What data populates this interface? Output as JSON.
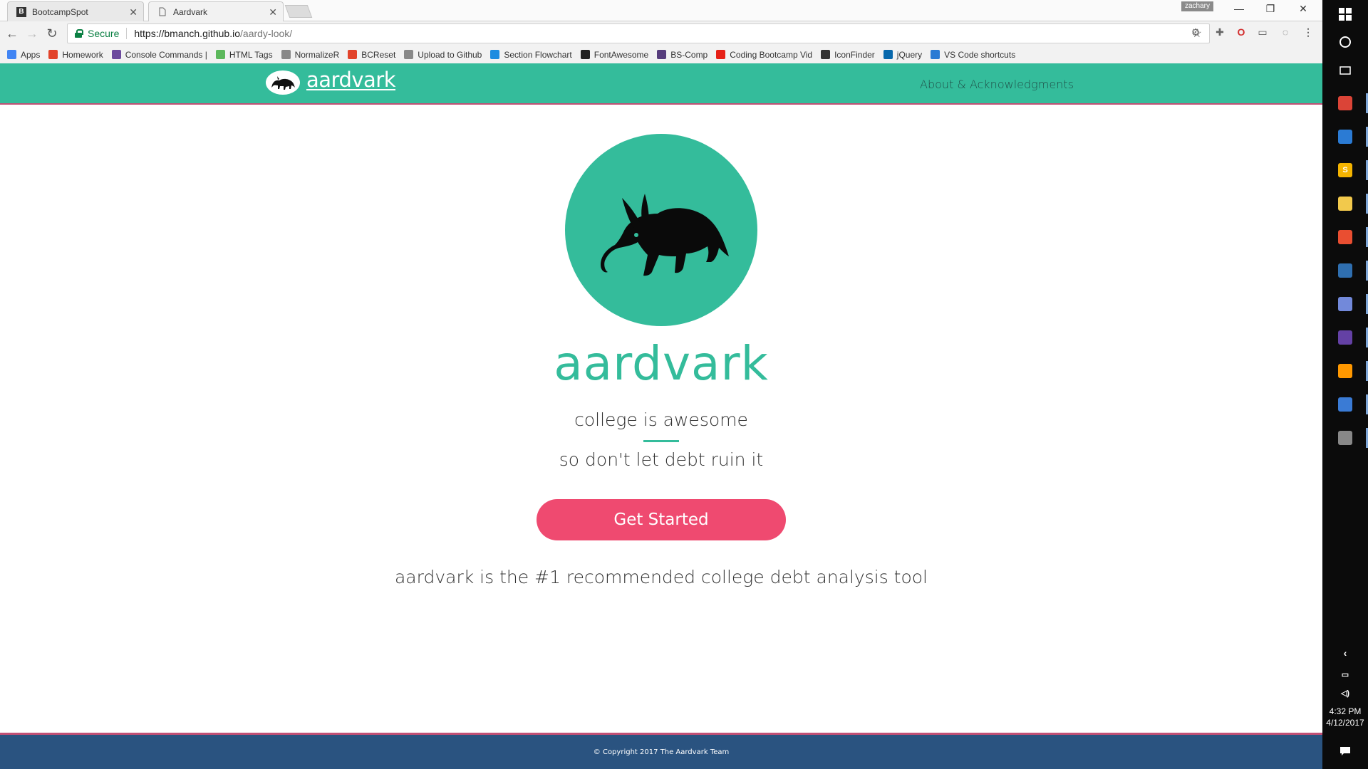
{
  "browser": {
    "tabs": [
      {
        "label": "BootcampSpot",
        "favicon": "B"
      },
      {
        "label": "Aardvark",
        "favicon": "page-icon"
      }
    ],
    "user_badge": "zachary",
    "address": {
      "secure_label": "Secure",
      "url_host": "https://bmanch.github.io",
      "url_path": "/aardy-look/"
    },
    "bookmarks": [
      {
        "label": "Apps",
        "icon": "apps-grid-icon",
        "color": "#4285f4"
      },
      {
        "label": "Homework",
        "icon": "gitlab-icon",
        "color": "#e2432a"
      },
      {
        "label": "Console Commands |",
        "icon": "slack-icon",
        "color": "#6c4a9e"
      },
      {
        "label": "HTML Tags",
        "icon": "html-icon",
        "color": "#5cb85c"
      },
      {
        "label": "NormalizeR",
        "icon": "page-icon",
        "color": "#888888"
      },
      {
        "label": "BCReset",
        "icon": "gitlab-icon",
        "color": "#e2432a"
      },
      {
        "label": "Upload to Github",
        "icon": "page-icon",
        "color": "#888888"
      },
      {
        "label": "Section Flowchart",
        "icon": "flowchart-icon",
        "color": "#1d8ce0"
      },
      {
        "label": "FontAwesome",
        "icon": "flag-icon",
        "color": "#222222"
      },
      {
        "label": "BS-Comp",
        "icon": "bootstrap-icon",
        "color": "#563d7c"
      },
      {
        "label": "Coding Bootcamp Vid",
        "icon": "youtube-icon",
        "color": "#e62117"
      },
      {
        "label": "IconFinder",
        "icon": "iconfinder-icon",
        "color": "#333333"
      },
      {
        "label": "jQuery",
        "icon": "jquery-icon",
        "color": "#0868ac"
      },
      {
        "label": "VS Code shortcuts",
        "icon": "vscode-icon",
        "color": "#2b7bd4"
      }
    ]
  },
  "site": {
    "brand": "aardvark",
    "nav_about": "About & Acknowledgments",
    "hero_title": "aardvark",
    "tagline_1": "college is awesome",
    "tagline_2": "so don't let debt ruin it",
    "cta": "Get Started",
    "pitch": "aardvark is the #1 recommended college debt analysis tool",
    "footer": "© Copyright 2017 The Aardvark Team",
    "colors": {
      "primary": "#34bc9b",
      "accent": "#ef4a70",
      "footer": "#2a5380",
      "border": "#c25075"
    }
  },
  "taskbar": {
    "apps": [
      {
        "name": "chrome",
        "glyph": "",
        "color": "#db4437"
      },
      {
        "name": "vscode",
        "glyph": "",
        "color": "#2b7bd4"
      },
      {
        "name": "slides",
        "glyph": "S",
        "color": "#f4b400"
      },
      {
        "name": "file-explorer",
        "glyph": "",
        "color": "#f2c94c"
      },
      {
        "name": "git",
        "glyph": "",
        "color": "#e94e31"
      },
      {
        "name": "ide",
        "glyph": "",
        "color": "#2f6fb0"
      },
      {
        "name": "discord",
        "glyph": "",
        "color": "#7289da"
      },
      {
        "name": "twitch",
        "glyph": "",
        "color": "#6441a5"
      },
      {
        "name": "sublime",
        "glyph": "",
        "color": "#ff9800"
      },
      {
        "name": "window",
        "glyph": "",
        "color": "#3a7bd5"
      },
      {
        "name": "notes",
        "glyph": "",
        "color": "#888888"
      }
    ],
    "clock_time": "4:32 PM",
    "clock_date": "4/12/2017"
  }
}
